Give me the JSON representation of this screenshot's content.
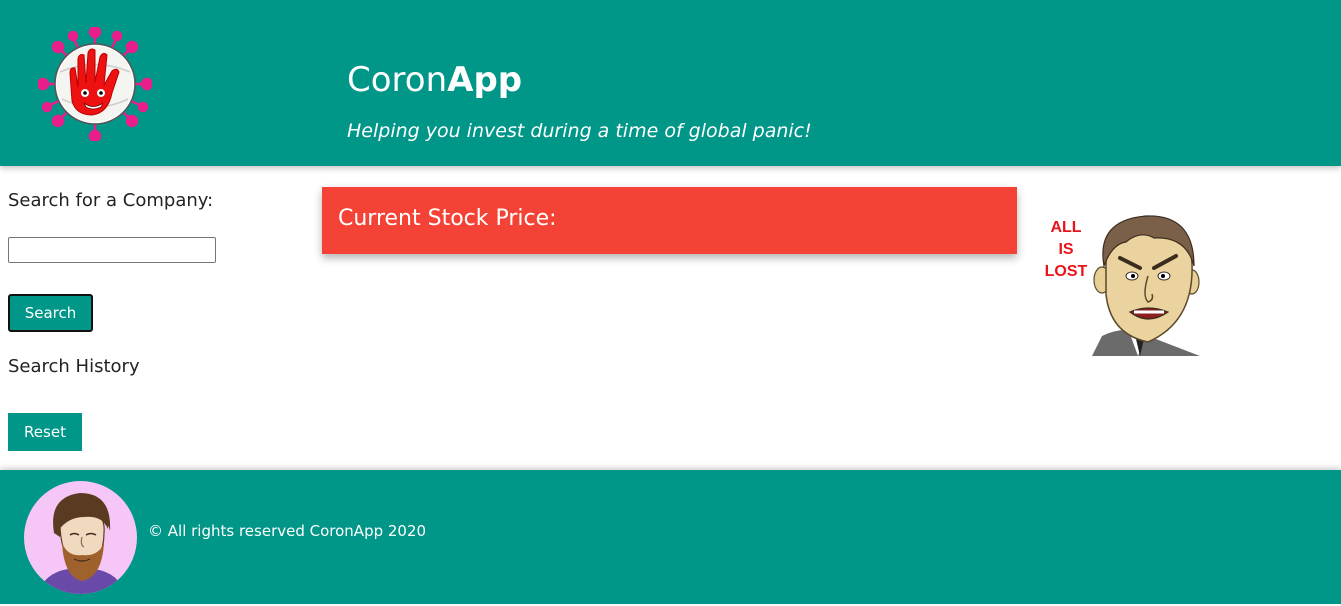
{
  "header": {
    "title_light": "Coron",
    "title_bold": "App",
    "tagline": "Helping you invest during a time of global panic!"
  },
  "sidebar": {
    "search_label": "Search for a Company:",
    "search_value": "",
    "search_button": "Search",
    "history_label": "Search History",
    "reset_button": "Reset"
  },
  "main": {
    "price_label": "Current Stock Price:"
  },
  "meme": {
    "caption_line1": "ALL",
    "caption_line2": "IS",
    "caption_line3": "LOST"
  },
  "footer": {
    "copyright": "© All rights reserved CoronApp 2020"
  },
  "colors": {
    "primary": "#009688",
    "price_card": "#f44336",
    "virus_spike": "#e91e8c",
    "hand_red": "#ee1111"
  },
  "icons": {
    "logo": "virus-volleyball-logo",
    "meme": "panicking-man-cartoon",
    "avatar": "bearded-man-avatar"
  }
}
